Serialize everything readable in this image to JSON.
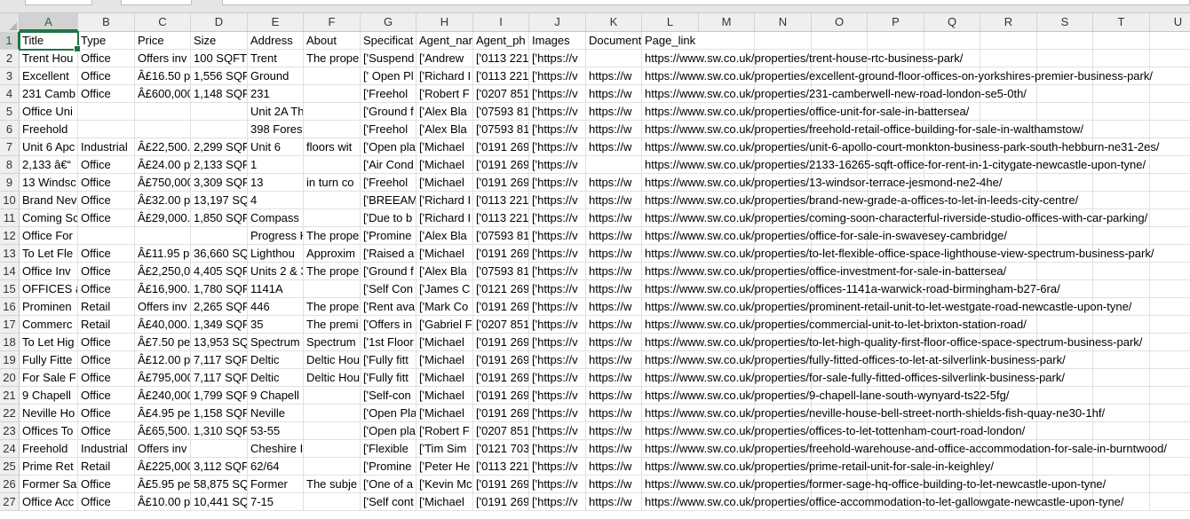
{
  "sheet": {
    "columns": [
      {
        "letter": "A",
        "w": 66
      },
      {
        "letter": "B",
        "w": 64
      },
      {
        "letter": "C",
        "w": 63
      },
      {
        "letter": "D",
        "w": 64
      },
      {
        "letter": "E",
        "w": 63
      },
      {
        "letter": "F",
        "w": 64
      },
      {
        "letter": "G",
        "w": 63
      },
      {
        "letter": "H",
        "w": 64
      },
      {
        "letter": "I",
        "w": 63
      },
      {
        "letter": "J",
        "w": 64
      },
      {
        "letter": "K",
        "w": 63
      },
      {
        "letter": "L",
        "w": 64
      },
      {
        "letter": "M",
        "w": 63
      },
      {
        "letter": "N",
        "w": 64
      },
      {
        "letter": "O",
        "w": 63
      },
      {
        "letter": "P",
        "w": 64
      },
      {
        "letter": "Q",
        "w": 63
      },
      {
        "letter": "R",
        "w": 64
      },
      {
        "letter": "S",
        "w": 63
      },
      {
        "letter": "T",
        "w": 64
      },
      {
        "letter": "U",
        "w": 64
      }
    ],
    "selected_cell": "A1",
    "rows": [
      {
        "n": "1",
        "cells": [
          "Title",
          "Type",
          "Price",
          "Size",
          "Address",
          "About",
          "Specificat",
          "Agent_nar",
          "Agent_ph",
          "Images",
          "Document",
          "Page_link"
        ]
      },
      {
        "n": "2",
        "cells": [
          "Trent Hou",
          "Office",
          "Offers inv",
          "100 SQFT (",
          "Trent",
          "The prope",
          "['Suspend",
          "['Andrew",
          "['0113 221",
          "['https://v",
          "",
          "https://www.sw.co.uk/properties/trent-house-rtc-business-park/"
        ]
      },
      {
        "n": "3",
        "cells": [
          "Excellent",
          "Office",
          "Â£16.50 p",
          "1,556 SQF",
          "Ground",
          "",
          "[' Open Pl",
          "['Richard I",
          "['0113 221",
          "['https://v",
          "https://w",
          "https://www.sw.co.uk/properties/excellent-ground-floor-offices-on-yorkshires-premier-business-park/"
        ]
      },
      {
        "n": "4",
        "cells": [
          "231 Camb",
          "Office",
          "Â£600,000",
          "1,148 SQF",
          "231",
          "",
          "['Freehol",
          "['Robert F",
          "['0207 851",
          "['https://v",
          "https://w",
          "https://www.sw.co.uk/properties/231-camberwell-new-road-london-se5-0th/"
        ]
      },
      {
        "n": "5",
        "cells": [
          "Office Uni",
          "",
          "",
          "",
          "Unit 2A Th",
          "",
          "['Ground f",
          "['Alex Bla",
          "['07593 81",
          "['https://v",
          "https://w",
          "https://www.sw.co.uk/properties/office-unit-for-sale-in-battersea/"
        ]
      },
      {
        "n": "6",
        "cells": [
          "Freehold",
          "",
          "",
          "",
          "398 Forest",
          "",
          "['Freehol",
          "['Alex Bla",
          "['07593 81",
          "['https://v",
          "https://w",
          "https://www.sw.co.uk/properties/freehold-retail-office-building-for-sale-in-walthamstow/"
        ]
      },
      {
        "n": "7",
        "cells": [
          "Unit 6 Apc",
          "Industrial",
          "Â£22,500.",
          "2,299 SQF",
          "Unit 6",
          "floors wit",
          "['Open pla",
          "['Michael",
          "['0191 269",
          "['https://v",
          "https://w",
          "https://www.sw.co.uk/properties/unit-6-apollo-court-monkton-business-park-south-hebburn-ne31-2es/"
        ]
      },
      {
        "n": "8",
        "cells": [
          "2,133 â€“",
          "Office",
          "Â£24.00 p",
          "2,133 SQF",
          "1",
          "",
          "['Air Cond",
          "['Michael",
          "['0191 269",
          "['https://v",
          "",
          "https://www.sw.co.uk/properties/2133-16265-sqft-office-for-rent-in-1-citygate-newcastle-upon-tyne/"
        ]
      },
      {
        "n": "9",
        "cells": [
          "13 Windsc",
          "Office",
          "Â£750,000",
          "3,309 SQF",
          "13",
          "in turn co",
          "['Freehol",
          "['Michael",
          "['0191 269",
          "['https://v",
          "https://w",
          "https://www.sw.co.uk/properties/13-windsor-terrace-jesmond-ne2-4he/"
        ]
      },
      {
        "n": "10",
        "cells": [
          "Brand Nev",
          "Office",
          "Â£32.00 p",
          "13,197 SQ",
          "4",
          "",
          "['BREEAM",
          "['Richard I",
          "['0113 221",
          "['https://v",
          "https://w",
          "https://www.sw.co.uk/properties/brand-new-grade-a-offices-to-let-in-leeds-city-centre/"
        ]
      },
      {
        "n": "11",
        "cells": [
          "Coming Sc",
          "Office",
          "Â£29,000.",
          "1,850 SQF",
          "Compass",
          "",
          "['Due to b",
          "['Richard I",
          "['0113 221",
          "['https://v",
          "https://w",
          "https://www.sw.co.uk/properties/coming-soon-characterful-riverside-studio-offices-with-car-parking/"
        ]
      },
      {
        "n": "12",
        "cells": [
          "Office For",
          "",
          "",
          "",
          "Progress H",
          "The prope",
          "['Promine",
          "['Alex Bla",
          "['07593 81",
          "['https://v",
          "https://w",
          "https://www.sw.co.uk/properties/office-for-sale-in-swavesey-cambridge/"
        ]
      },
      {
        "n": "13",
        "cells": [
          "To Let Fle",
          "Office",
          "Â£11.95 p",
          "36,660 SQ",
          "Lighthou",
          "Approxim",
          "['Raised a",
          "['Michael",
          "['0191 269",
          "['https://v",
          "https://w",
          "https://www.sw.co.uk/properties/to-let-flexible-office-space-lighthouse-view-spectrum-business-park/"
        ]
      },
      {
        "n": "14",
        "cells": [
          "Office Inv",
          "Office",
          "Â£2,250,0",
          "4,405 SQF",
          "Units 2 & 3",
          "The prope",
          "['Ground f",
          "['Alex Bla",
          "['07593 81",
          "['https://v",
          "https://w",
          "https://www.sw.co.uk/properties/office-investment-for-sale-in-battersea/"
        ]
      },
      {
        "n": "15",
        "cells": [
          "OFFICES â",
          "Office",
          "Â£16,900.",
          "1,780 SQF",
          "1141A",
          "",
          "['Self Con",
          "['James C",
          "['0121 269",
          "['https://v",
          "https://w",
          "https://www.sw.co.uk/properties/offices-1141a-warwick-road-birmingham-b27-6ra/"
        ]
      },
      {
        "n": "16",
        "cells": [
          "Prominen",
          "Retail",
          "Offers inv",
          "2,265 SQF",
          "446",
          "The prope",
          "['Rent ava",
          "['Mark Co",
          "['0191 269",
          "['https://v",
          "https://w",
          "https://www.sw.co.uk/properties/prominent-retail-unit-to-let-westgate-road-newcastle-upon-tyne/"
        ]
      },
      {
        "n": "17",
        "cells": [
          "Commerc",
          "Retail",
          "Â£40,000.",
          "1,349 SQF",
          "35",
          "The premi",
          "['Offers in",
          "['Gabriel F",
          "['0207 851",
          "['https://v",
          "https://w",
          "https://www.sw.co.uk/properties/commercial-unit-to-let-brixton-station-road/"
        ]
      },
      {
        "n": "18",
        "cells": [
          "To Let Hig",
          "Office",
          "Â£7.50 pe",
          "13,953 SQ",
          "Spectrum",
          "Spectrum",
          "['1st Floor",
          "['Michael",
          "['0191 269",
          "['https://v",
          "https://w",
          "https://www.sw.co.uk/properties/to-let-high-quality-first-floor-office-space-spectrum-business-park/"
        ]
      },
      {
        "n": "19",
        "cells": [
          "Fully Fitte",
          "Office",
          "Â£12.00 p",
          "7,117 SQF",
          "Deltic",
          "Deltic Hou",
          "['Fully fitt",
          "['Michael",
          "['0191 269",
          "['https://v",
          "https://w",
          "https://www.sw.co.uk/properties/fully-fitted-offices-to-let-at-silverlink-business-park/"
        ]
      },
      {
        "n": "20",
        "cells": [
          "For Sale F",
          "Office",
          "Â£795,000",
          "7,117 SQF",
          "Deltic",
          "Deltic Hou",
          "['Fully fitt",
          "['Michael",
          "['0191 269",
          "['https://v",
          "https://w",
          "https://www.sw.co.uk/properties/for-sale-fully-fitted-offices-silverlink-business-park/"
        ]
      },
      {
        "n": "21",
        "cells": [
          "9 Chapell",
          "Office",
          "Â£240,000",
          "1,799 SQF",
          "9 Chapell",
          "",
          "['Self-con",
          "['Michael",
          "['0191 269",
          "['https://v",
          "https://w",
          "https://www.sw.co.uk/properties/9-chapell-lane-south-wynyard-ts22-5fg/"
        ]
      },
      {
        "n": "22",
        "cells": [
          "Neville Ho",
          "Office",
          "Â£4.95 pe",
          "1,158 SQF",
          "Neville",
          "",
          "['Open Pla",
          "['Michael",
          "['0191 269",
          "['https://v",
          "https://w",
          "https://www.sw.co.uk/properties/neville-house-bell-street-north-shields-fish-quay-ne30-1hf/"
        ]
      },
      {
        "n": "23",
        "cells": [
          "Offices To",
          "Office",
          "Â£65,500.",
          "1,310 SQF",
          "53-55",
          "",
          "['Open pla",
          "['Robert F",
          "['0207 851",
          "['https://v",
          "https://w",
          "https://www.sw.co.uk/properties/offices-to-let-tottenham-court-road-london/"
        ]
      },
      {
        "n": "24",
        "cells": [
          "Freehold",
          "Industrial",
          "Offers inv",
          "",
          "Cheshire I",
          "",
          "['Flexible",
          "['Tim Sim",
          "['0121 703",
          "['https://v",
          "https://w",
          "https://www.sw.co.uk/properties/freehold-warehouse-and-office-accommodation-for-sale-in-burntwood/"
        ]
      },
      {
        "n": "25",
        "cells": [
          "Prime Ret",
          "Retail",
          "Â£225,000",
          "3,112 SQF",
          "62/64",
          "",
          "['Promine",
          "['Peter He",
          "['0113 221",
          "['https://v",
          "https://w",
          "https://www.sw.co.uk/properties/prime-retail-unit-for-sale-in-keighley/"
        ]
      },
      {
        "n": "26",
        "cells": [
          "Former Sa",
          "Office",
          "Â£5.95 pe",
          "58,875 SQ",
          "Former",
          "The subje",
          "['One of a",
          "['Kevin Mc",
          "['0191 269",
          "['https://v",
          "https://w",
          "https://www.sw.co.uk/properties/former-sage-hq-office-building-to-let-newcastle-upon-tyne/"
        ]
      },
      {
        "n": "27",
        "cells": [
          "Office Acc",
          "Office",
          "Â£10.00 p",
          "10,441 SQ",
          "7-15",
          "",
          "['Self cont",
          "['Michael",
          "['0191 269",
          "['https://v",
          "https://w",
          "https://www.sw.co.uk/properties/office-accommodation-to-let-gallowgate-newcastle-upon-tyne/"
        ]
      }
    ]
  }
}
